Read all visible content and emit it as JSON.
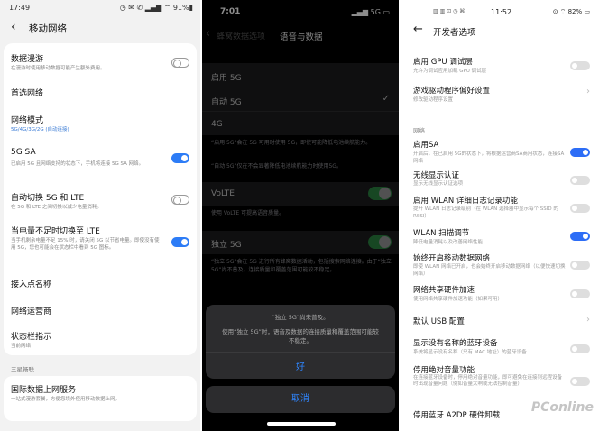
{
  "panel1": {
    "status": {
      "time": "17:49",
      "indicators": "◷ ✉ ✆ ▂▄▆ ⌔ 91%▮"
    },
    "header": {
      "back_icon": "‹",
      "title": "移动网络"
    },
    "rows": [
      {
        "title": "数据漫游",
        "subtitle": "在漫游时使用移动数据可能产生额外费用。",
        "toggle": "off"
      },
      {
        "title": "首选网络"
      },
      {
        "title": "网络模式",
        "subtitle": "5G/4G/3G/2G (自动连接)"
      },
      {
        "title": "5G SA",
        "subtitle": "已启用 5G 且网络支持的状态下，手机将连接 5G SA 网络。",
        "toggle": "on"
      },
      {
        "title": "自动切换 5G 和 LTE",
        "subtitle": "在 5G 和 LTE 之间切换以减少电量消耗。",
        "toggle": "off"
      },
      {
        "title": "当电量不足时切换至 LTE",
        "subtitle": "当手机剩余电量不足 15% 时，请关闭 5G 以节省电量。即使没有使用 5G，您也可能会在状态栏中看到 5G 图标。",
        "toggle": "on"
      },
      {
        "title": "接入点名称"
      },
      {
        "title": "网络运营商"
      },
      {
        "title": "状态栏指示",
        "subtitle": "当前网络"
      }
    ],
    "section": "三星畅联",
    "intl": {
      "title": "国际数据上网服务",
      "subtitle": "一站式漫游套餐，方便您境外使用移动数据上网。"
    }
  },
  "panel2": {
    "status": {
      "time": "7:01",
      "indicators": "▂▄▆ 5G ▭"
    },
    "nav": {
      "back_icon": "‹",
      "back_label": "蜂窝数据选项",
      "title": "语音与数据"
    },
    "options": [
      "启用 5G",
      "自动 5G",
      "4G"
    ],
    "checkmark": "✓",
    "note1": "“启用 5G”会在 5G 可用时使用 5G，即使可能降低电池续航能力。",
    "note2": "“自动 5G”仅在不会显著降低电池续航能力时使用5G。",
    "volte": {
      "label": "VoLTE",
      "note": "使用 VoLTE 可提高语音质量。"
    },
    "standalone": {
      "label": "独立 5G",
      "note": "“独立 5G”会在 5G 进行所有蜂窝数据活动，包括搜索网络连接。由于“独立 5G”尚不普及，连接质量和覆盖范围可能较不稳定。"
    },
    "sheet": {
      "message_title": "“独立 5G”尚未普及。",
      "message_body": "使用“独立 5G”时，语音及数据的连接质量和覆盖范围可能较不稳定。",
      "ok": "好",
      "cancel": "取消"
    }
  },
  "panel3": {
    "status": {
      "left": "▥ ▥ ⊡ ◷ ⌘",
      "time": "11:52",
      "indicators": "⊙ ⌔ 82% ▭"
    },
    "header": {
      "back_icon": "←",
      "title": "开发者选项"
    },
    "rows": [
      {
        "title": "启用 GPU 调试层",
        "subtitle": "允许为调试应用加载 GPU 调试层",
        "control": "toggle-off"
      },
      {
        "title": "游戏驱动程序偏好设置",
        "subtitle": "修改驱动程序设置",
        "control": "chevron"
      }
    ],
    "section": "网络",
    "network_rows": [
      {
        "title": "启用SA",
        "subtitle": "开启后，在已启用 5G的状态下，将根据运营商SA商用状态，连接SA网络",
        "control": "toggle-on"
      },
      {
        "title": "无线显示认证",
        "subtitle": "显示无线显示认证选项",
        "control": "toggle-off"
      },
      {
        "title": "启用 WLAN 详细日志记录功能",
        "subtitle": "提升 WLAN 日志记录级别（在 WLAN 选择器中显示每个 SSID 的 RSSI）",
        "control": "toggle-off"
      },
      {
        "title": "WLAN 扫描调节",
        "subtitle": "降低电量消耗以及改善网络性能",
        "control": "toggle-on"
      },
      {
        "title": "始终开启移动数据网络",
        "subtitle": "即使 WLAN 网络已开启，也会始终开启移动数据网络（以便快速切换网络）",
        "control": "toggle-off"
      },
      {
        "title": "网络共享硬件加速",
        "subtitle": "使用网络共享硬件加速功能（如果可用）",
        "control": "toggle-off"
      },
      {
        "title": "默认 USB 配置",
        "control": "chevron"
      },
      {
        "title": "显示没有名称的蓝牙设备",
        "subtitle": "系统将显示没有名称（只有 MAC 地址）的蓝牙设备",
        "control": "toggle-off"
      },
      {
        "title": "停用绝对音量功能",
        "subtitle": "在连接蓝牙设备时，停用绝对音量功能，即可避免在连接到远程设备时出现音量问题（例如音量太响或无法控制音量）",
        "control": "toggle-off"
      },
      {
        "title": "停用蓝牙 A2DP 硬件卸载"
      }
    ],
    "watermark": "PConline",
    "chevron": "›"
  }
}
